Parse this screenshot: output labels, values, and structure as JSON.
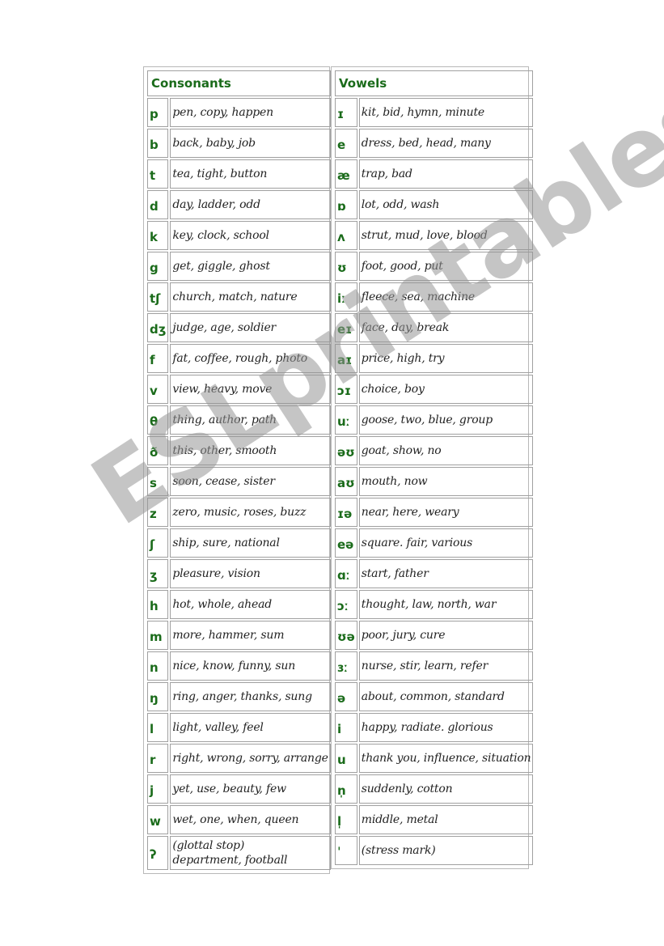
{
  "consonants": {
    "title": "Consonants",
    "rows": [
      {
        "symbol": "p",
        "examples": "pen, copy, happen"
      },
      {
        "symbol": "b",
        "examples": "back, baby, job"
      },
      {
        "symbol": "t",
        "examples": "tea, tight, button"
      },
      {
        "symbol": "d",
        "examples": "day, ladder, odd"
      },
      {
        "symbol": "k",
        "examples": "key, clock, school"
      },
      {
        "symbol": "g",
        "examples": "get, giggle, ghost"
      },
      {
        "symbol": "tʃ",
        "examples": "church, match, nature"
      },
      {
        "symbol": "dʒ",
        "examples": "judge, age, soldier"
      },
      {
        "symbol": "f",
        "examples": "fat, coffee, rough, photo"
      },
      {
        "symbol": "v",
        "examples": "view, heavy, move"
      },
      {
        "symbol": "θ",
        "examples": "thing, author, path"
      },
      {
        "symbol": "ð",
        "examples": "this, other, smooth"
      },
      {
        "symbol": "s",
        "examples": "soon, cease, sister"
      },
      {
        "symbol": "z",
        "examples": "zero, music, roses, buzz"
      },
      {
        "symbol": "ʃ",
        "examples": "ship, sure, national"
      },
      {
        "symbol": "ʒ",
        "examples": "pleasure, vision"
      },
      {
        "symbol": "h",
        "examples": "hot, whole, ahead"
      },
      {
        "symbol": "m",
        "examples": "more, hammer, sum"
      },
      {
        "symbol": "n",
        "examples": "nice, know, funny, sun"
      },
      {
        "symbol": "ŋ",
        "examples": "ring, anger, thanks, sung"
      },
      {
        "symbol": "l",
        "examples": "light, valley, feel"
      },
      {
        "symbol": "r",
        "examples": "right, wrong, sorry, arrange"
      },
      {
        "symbol": "j",
        "examples": "yet, use, beauty, few"
      },
      {
        "symbol": "w",
        "examples": "wet, one, when, queen"
      },
      {
        "symbol": "ʔ",
        "examples_line1": "(glottal stop)",
        "examples_line2": "department, football"
      }
    ]
  },
  "vowels": {
    "title": "Vowels",
    "rows": [
      {
        "symbol": "ɪ",
        "examples": "kit, bid, hymn, minute"
      },
      {
        "symbol": "e",
        "examples": "dress, bed, head, many"
      },
      {
        "symbol": "æ",
        "examples": "trap, bad"
      },
      {
        "symbol": "ɒ",
        "examples": "lot, odd, wash"
      },
      {
        "symbol": "ʌ",
        "examples": "strut, mud, love, blood"
      },
      {
        "symbol": "ʊ",
        "examples": "foot, good, put"
      },
      {
        "symbol": "iː",
        "examples": "fleece, sea, machine"
      },
      {
        "symbol": "eɪ",
        "examples": "face, day, break"
      },
      {
        "symbol": "aɪ",
        "examples": "price, high, try"
      },
      {
        "symbol": "ɔɪ",
        "examples": "choice, boy"
      },
      {
        "symbol": "uː",
        "examples": "goose, two, blue, group"
      },
      {
        "symbol": "əʊ",
        "examples": "goat, show, no"
      },
      {
        "symbol": "aʊ",
        "examples": "mouth, now"
      },
      {
        "symbol": "ɪə",
        "examples": "near, here, weary"
      },
      {
        "symbol": "eə",
        "examples": "square. fair, various"
      },
      {
        "symbol": "ɑː",
        "examples": "start, father"
      },
      {
        "symbol": "ɔː",
        "examples": "thought, law, north, war"
      },
      {
        "symbol": "ʊə",
        "examples": "poor, jury, cure"
      },
      {
        "symbol": "ɜː",
        "examples": "nurse, stir, learn, refer"
      },
      {
        "symbol": "ə",
        "examples": "about, common, standard"
      },
      {
        "symbol": "i",
        "examples": "happy, radiate. glorious"
      },
      {
        "symbol": "u",
        "examples": "thank you, influence, situation"
      },
      {
        "symbol": "n̩",
        "examples": "suddenly, cotton"
      },
      {
        "symbol": "l̩",
        "examples": "middle, metal"
      },
      {
        "symbol": "ˈ",
        "examples": "(stress mark)"
      }
    ]
  },
  "watermark": "ESLprintables.com",
  "colors": {
    "heading": "#1a6b1a",
    "border": "#a0a0a0",
    "watermark": "#969696"
  }
}
